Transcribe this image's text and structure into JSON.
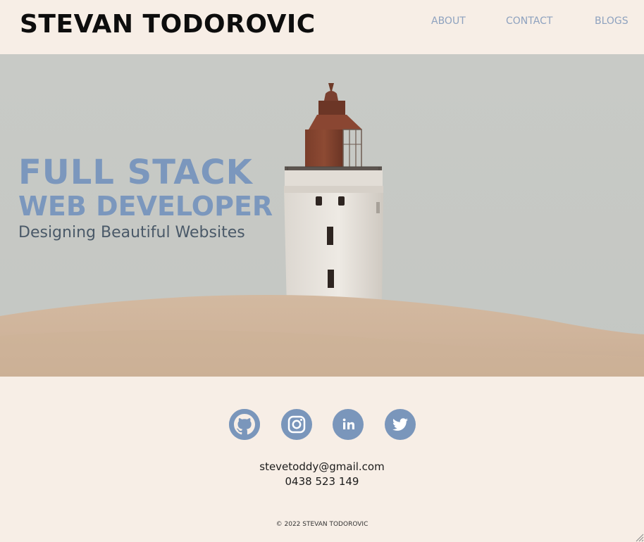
{
  "header": {
    "logo": "STEVAN TODOROVIC",
    "nav": [
      {
        "label": "ABOUT"
      },
      {
        "label": "CONTACT"
      },
      {
        "label": "BLOGS"
      }
    ]
  },
  "hero": {
    "line1": "FULL STACK",
    "line2": "WEB DEVELOPER",
    "line3": "Designing Beautiful Websites"
  },
  "socials": [
    {
      "icon": "github-icon"
    },
    {
      "icon": "instagram-icon"
    },
    {
      "icon": "linkedin-icon"
    },
    {
      "icon": "twitter-icon"
    }
  ],
  "contact": {
    "email": "stevetoddy@gmail.com",
    "phone": "0438 523 149"
  },
  "footer": {
    "copyright": "© 2022 STEVAN TODOROVIC"
  },
  "colors": {
    "background": "#f7eee6",
    "accent": "#7a96bb",
    "nav_text": "#8ea2bf"
  }
}
